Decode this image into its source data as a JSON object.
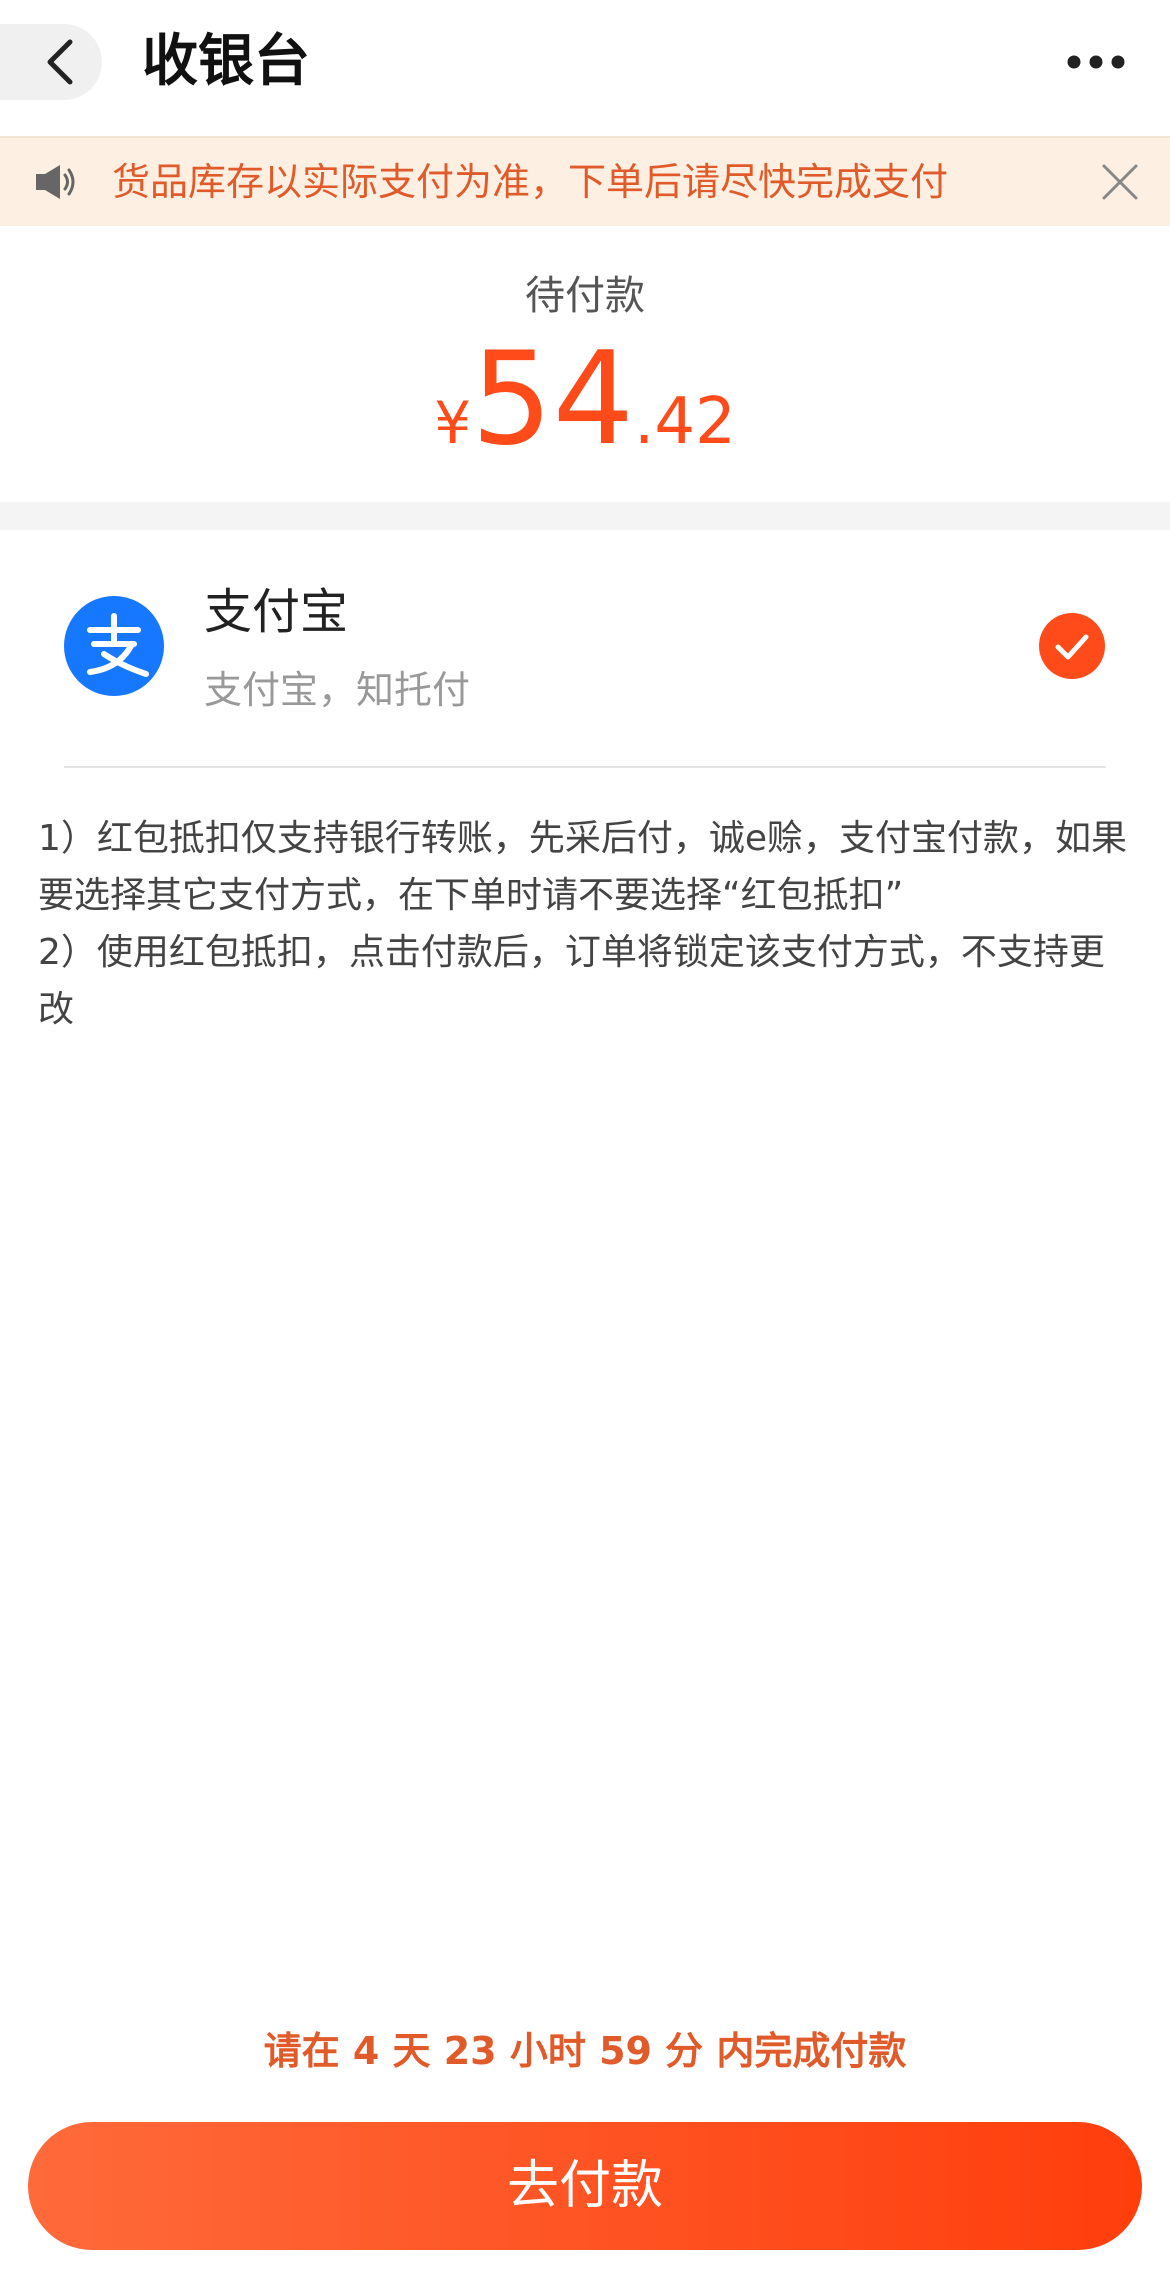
{
  "header": {
    "title": "收银台"
  },
  "notice": {
    "text": "货品库存以实际支付为准，下单后请尽快完成支付"
  },
  "amount": {
    "label": "待付款",
    "currency": "¥",
    "integer": "54",
    "decimal": ".42"
  },
  "payment_methods": [
    {
      "name": "支付宝",
      "subtitle": "支付宝，知托付",
      "selected": true
    }
  ],
  "notes": [
    "1）红包抵扣仅支持银行转账，先采后付，诚e赊，支付宝付款，如果要选择其它支付方式，在下单时请不要选择“红包抵扣”",
    "2）使用红包抵扣，点击付款后，订单将锁定该支付方式，不支持更改"
  ],
  "countdown": "请在 4 天 23 小时 59 分 内完成付款",
  "pay_button": {
    "label": "去付款"
  },
  "colors": {
    "accent": "#ff4a1a",
    "notice_bg": "#fdf0e2",
    "notice_text": "#e05a2a",
    "alipay_blue": "#1677ff"
  }
}
